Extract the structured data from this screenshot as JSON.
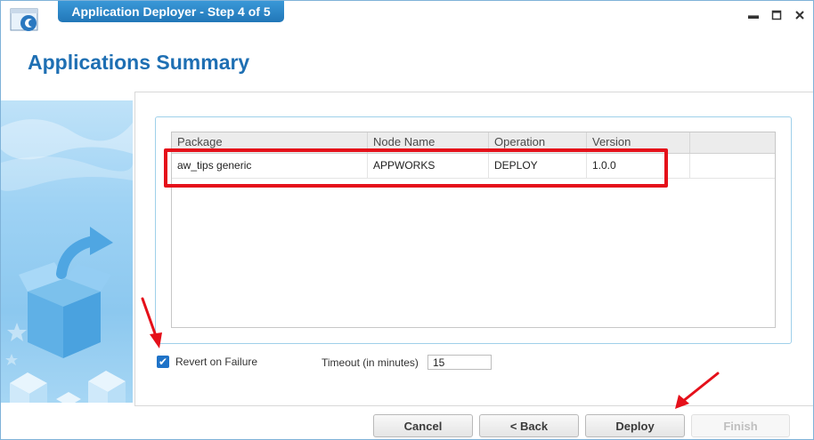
{
  "window": {
    "title": "Application Deployer - Step 4 of 5",
    "controls": [
      "minimize-icon",
      "maximize-icon",
      "close-icon"
    ]
  },
  "header": {
    "title": "Applications Summary"
  },
  "grid": {
    "columns": [
      "Package",
      "Node Name",
      "Operation",
      "Version"
    ],
    "rows": [
      {
        "package": "aw_tips generic",
        "node": "APPWORKS",
        "operation": "DEPLOY",
        "version": "1.0.0"
      }
    ]
  },
  "options": {
    "revert_label": "Revert on Failure",
    "revert_checked": true,
    "timeout_label": "Timeout (in minutes)",
    "timeout_value": "15"
  },
  "buttons": {
    "cancel": "Cancel",
    "back": "< Back",
    "deploy": "Deploy",
    "finish": "Finish"
  },
  "colors": {
    "accent": "#1e6fb3",
    "title_tab": "#2a85c7",
    "annotation": "#e5101a"
  }
}
